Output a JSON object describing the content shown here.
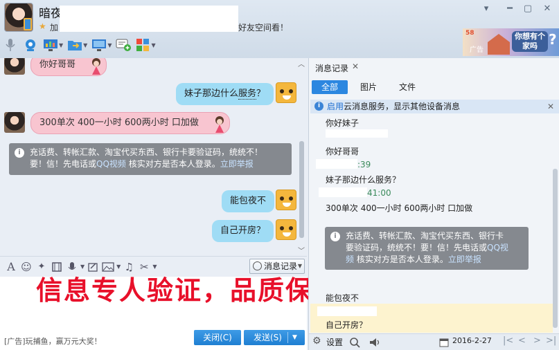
{
  "header": {
    "nickname": "暗夜",
    "signature_prefix": "加",
    "signature_suffix": "好友空间看！",
    "ad_brand": "58",
    "ad_label": "广告",
    "ad_bubble": "你想有个家吗"
  },
  "window_buttons": {
    "pin": "▾",
    "minimize": "━",
    "maximize": "▢",
    "close": "✕"
  },
  "chat": {
    "messages": [
      {
        "side": "left",
        "text": "你好哥哥"
      },
      {
        "side": "right",
        "text_pre": "妹子那边什么",
        "text_dotted": "服务",
        "text_post": "？"
      },
      {
        "side": "left",
        "text": "300单次 400一小时 600两小时 口加做"
      },
      {
        "side": "right",
        "text": "能包夜不"
      },
      {
        "side": "right",
        "text": "自己开房？"
      }
    ],
    "warning": {
      "line1": "充话费、转帐汇款、淘宝代买东西、银行卡要验证码，统统不！",
      "line2_pre": "要！信！先电话或",
      "qq_video": "QQ视频",
      "line2_mid": " 核实对方是否本人登录。",
      "report": "立即举报"
    }
  },
  "input_toolbar": {
    "history_label": "消息记录"
  },
  "overlay_text": "信息专人验证，品质保证",
  "bottom": {
    "ad_text": "[广告]玩捕鱼，赢万元大奖！",
    "close_label": "关闭(C)",
    "send_label": "发送(S)"
  },
  "history": {
    "panel_title": "消息记录",
    "tabs": [
      "全部",
      "图片",
      "文件"
    ],
    "cloud_notice_link": "启用",
    "cloud_notice_text": "云消息服务，显示其他设备消息",
    "entries": [
      {
        "text": "你好妹子"
      },
      {
        "text": "你好哥哥"
      },
      {
        "time_tail": ":39"
      },
      {
        "text": "妹子那边什么服务？"
      },
      {
        "time_tail": "41:00"
      },
      {
        "text": "300单次 400一小时 600两小时 口加做"
      },
      {
        "text": "能包夜不"
      },
      {
        "text": "自己开房？"
      }
    ],
    "warning": {
      "line1": "充话费、转帐汇款、淘宝代买东西、银行卡",
      "line2_pre": "要验证码，统统不！要！信！先电话或",
      "qq_video_1": "QQ视",
      "qq_video_2": "频",
      "line3_mid": " 核实对方是否本人登录。",
      "report": "立即举报"
    },
    "footer": {
      "settings_label": "设置",
      "date": "2016-2-27"
    }
  }
}
